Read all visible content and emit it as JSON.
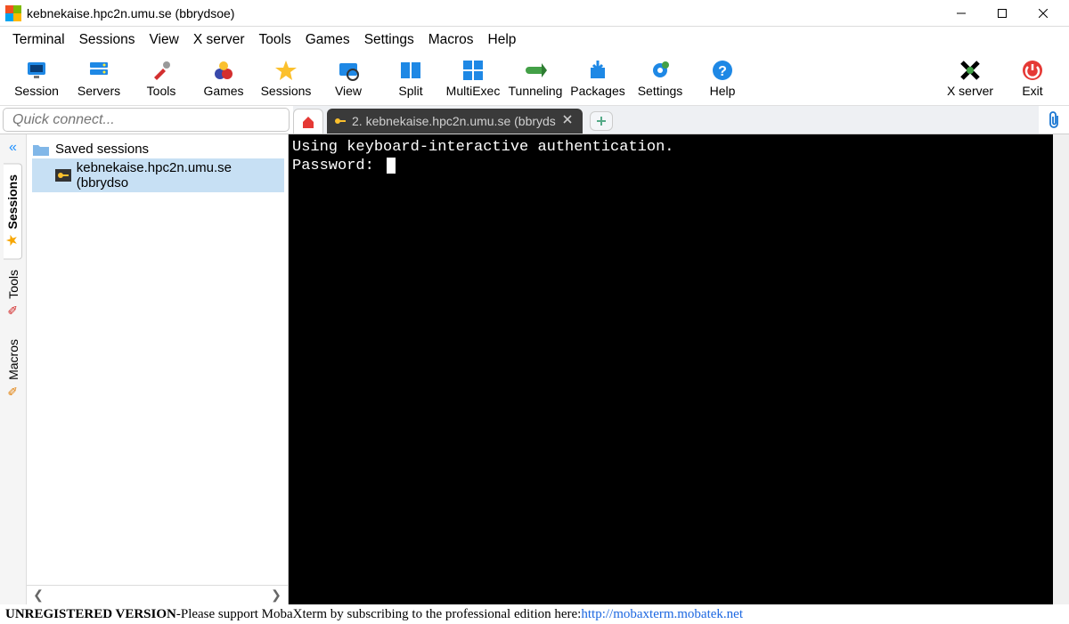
{
  "title": "kebnekaise.hpc2n.umu.se (bbrydsoe)",
  "menu": [
    "Terminal",
    "Sessions",
    "View",
    "X server",
    "Tools",
    "Games",
    "Settings",
    "Macros",
    "Help"
  ],
  "toolbar": [
    {
      "id": "session",
      "label": "Session"
    },
    {
      "id": "servers",
      "label": "Servers"
    },
    {
      "id": "tools",
      "label": "Tools"
    },
    {
      "id": "games",
      "label": "Games"
    },
    {
      "id": "sessions",
      "label": "Sessions"
    },
    {
      "id": "view",
      "label": "View"
    },
    {
      "id": "split",
      "label": "Split"
    },
    {
      "id": "multiexec",
      "label": "MultiExec"
    },
    {
      "id": "tunneling",
      "label": "Tunneling"
    },
    {
      "id": "packages",
      "label": "Packages"
    },
    {
      "id": "settings",
      "label": "Settings"
    },
    {
      "id": "help",
      "label": "Help"
    }
  ],
  "toolbar_right": [
    {
      "id": "xserver",
      "label": "X server"
    },
    {
      "id": "exit",
      "label": "Exit"
    }
  ],
  "quick_placeholder": "Quick connect...",
  "tab_label": "2. kebnekaise.hpc2n.umu.se (bbryds",
  "vtabs": [
    {
      "id": "sessions",
      "label": "Sessions",
      "icon": "★",
      "color": "#f7a600",
      "active": true
    },
    {
      "id": "tools",
      "label": "Tools",
      "icon": "✎",
      "color": "#d01a1a",
      "active": false
    },
    {
      "id": "macros",
      "label": "Macros",
      "icon": "✎",
      "color": "#e07b00",
      "active": false
    }
  ],
  "tree": {
    "folder": "Saved sessions",
    "item": "kebnekaise.hpc2n.umu.se (bbrydso"
  },
  "terminal": {
    "line1": "Using keyboard-interactive authentication.",
    "line2": "Password: "
  },
  "footer": {
    "strong": "UNREGISTERED VERSION",
    "sep": "  -  ",
    "msg": "Please support MobaXterm by subscribing to the professional edition here:  ",
    "link": "http://mobaxterm.mobatek.net"
  }
}
